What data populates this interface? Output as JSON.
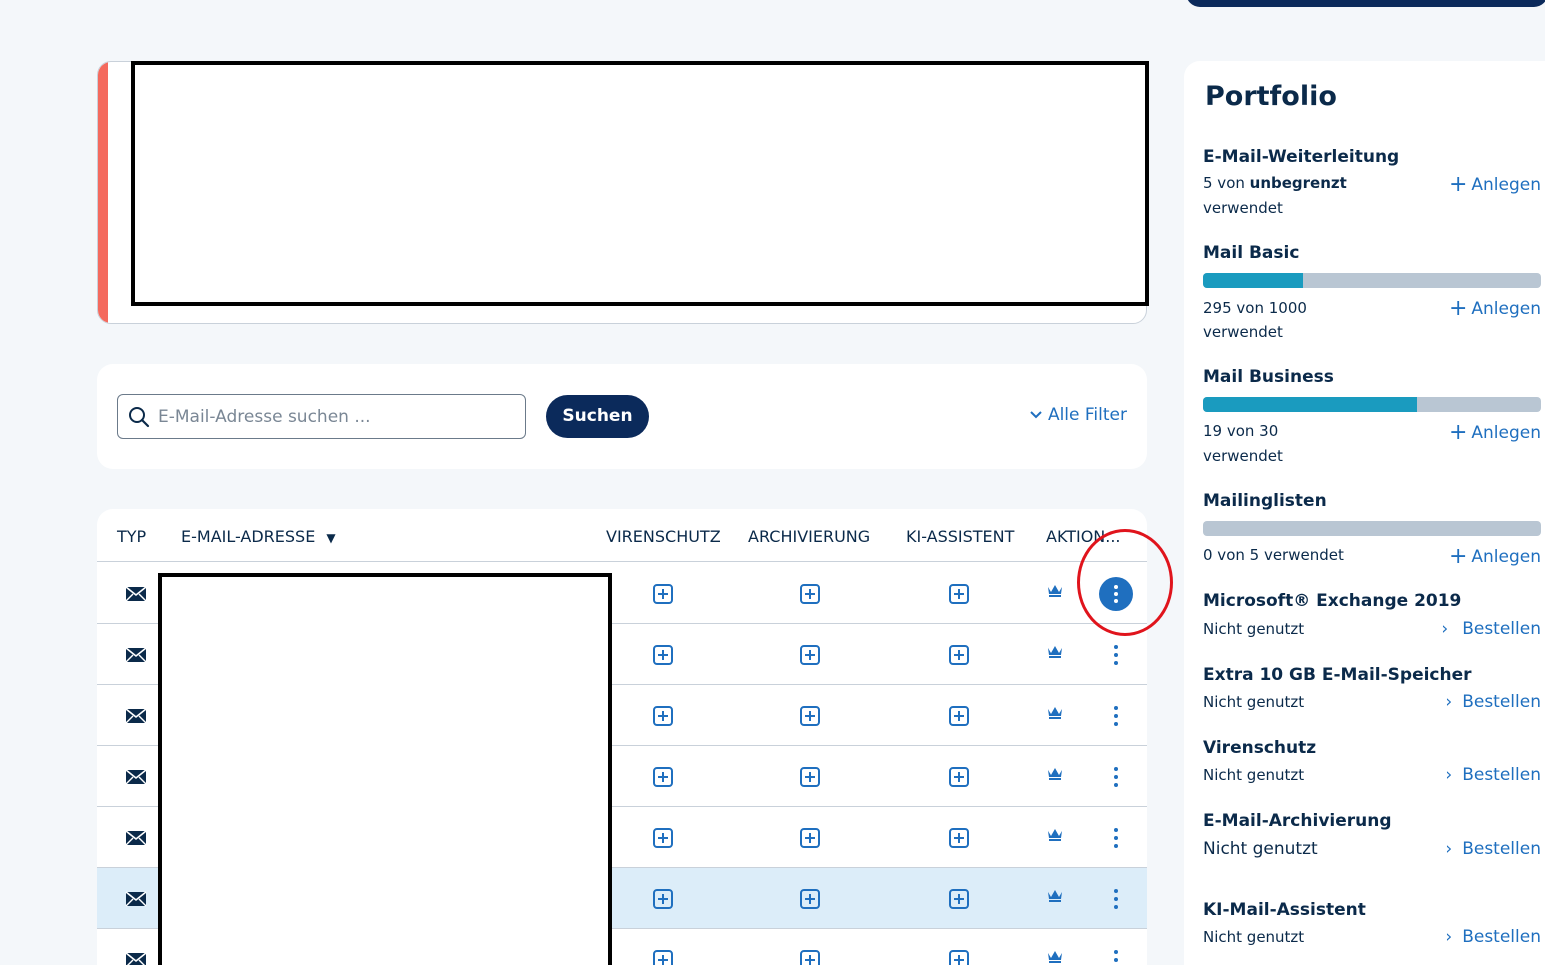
{
  "search": {
    "placeholder": "E-Mail-Adresse suchen ...",
    "button_label": "Suchen",
    "filter_label": "Alle Filter"
  },
  "table": {
    "headers": {
      "typ": "TYP",
      "email": "E-MAIL-ADRESSE",
      "sort_indicator": "▼",
      "virenschutz": "VIRENSCHUTZ",
      "archivierung": "ARCHIVIERUNG",
      "ki": "KI-ASSISTENT",
      "aktion": "AKTION..."
    },
    "row_icon": "mail-icon",
    "cell_icons": [
      "plus-square-icon",
      "plus-square-icon",
      "plus-square-icon",
      "crown-icon",
      "kebab-menu-icon"
    ],
    "highlighted_row": 6
  },
  "portfolio": {
    "title": "Portfolio",
    "items": [
      {
        "name": "E-Mail-Weiterleitung",
        "used_prefix": "5 von ",
        "used_bold": "unbegrenzt",
        "used_suffix": "verwendet",
        "action": "Anlegen"
      },
      {
        "name": "Mail Basic",
        "used": "295 von 1000",
        "used_suffix": "verwendet",
        "action": "Anlegen",
        "fill": 0.295
      },
      {
        "name": "Mail Business",
        "used": "19 von 30",
        "used_suffix": "verwendet",
        "action": "Anlegen",
        "fill": 0.633
      },
      {
        "name": "Mailinglisten",
        "used": "0 von 5 verwendet",
        "action": "Anlegen",
        "fill": 0
      },
      {
        "name": "Microsoft® Exchange 2019",
        "status": "Nicht genutzt",
        "action": "Bestellen"
      },
      {
        "name": "Extra 10 GB E-Mail-Speicher",
        "status": "Nicht genutzt",
        "action": "Bestellen"
      },
      {
        "name": "Virenschutz",
        "status": "Nicht genutzt",
        "action": "Bestellen"
      },
      {
        "name": "E-Mail-Archivierung",
        "status": "Nicht genutzt",
        "action": "Bestellen"
      },
      {
        "name": "KI-Mail-Assistent",
        "status": "Nicht genutzt",
        "action": "Bestellen"
      }
    ]
  },
  "colors": {
    "primary_dark": "#0b2a5b",
    "link_blue": "#1f6fbf",
    "progress_teal": "#1a9bbf",
    "alert_red": "#f46a5e",
    "highlight_row": "#dcedf9",
    "annotation_red": "#e0141c"
  }
}
